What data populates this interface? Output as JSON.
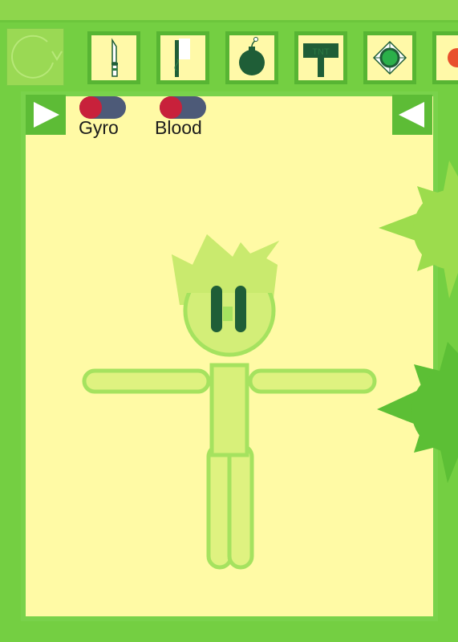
{
  "toolbar": {
    "items": [
      {
        "name": "knife"
      },
      {
        "name": "sword"
      },
      {
        "name": "bomb"
      },
      {
        "name": "tnt-sign",
        "label": "TNT"
      },
      {
        "name": "mine"
      },
      {
        "name": "partial-item"
      }
    ]
  },
  "toggles": [
    {
      "label": "Gyro",
      "state": "off"
    },
    {
      "label": "Blood",
      "state": "off"
    }
  ],
  "colors": {
    "frame": "#74cf42",
    "field": "#fffaa5",
    "ragdoll": "#d8f07a",
    "ragdoll_outline": "#a5e25f",
    "eyes": "#1f5e37",
    "spike_ball_top": "#9cdc4d",
    "spike_ball_bottom": "#5cbf35",
    "toggle_knob": "#c8213b",
    "toggle_track": "#4d5a78"
  }
}
